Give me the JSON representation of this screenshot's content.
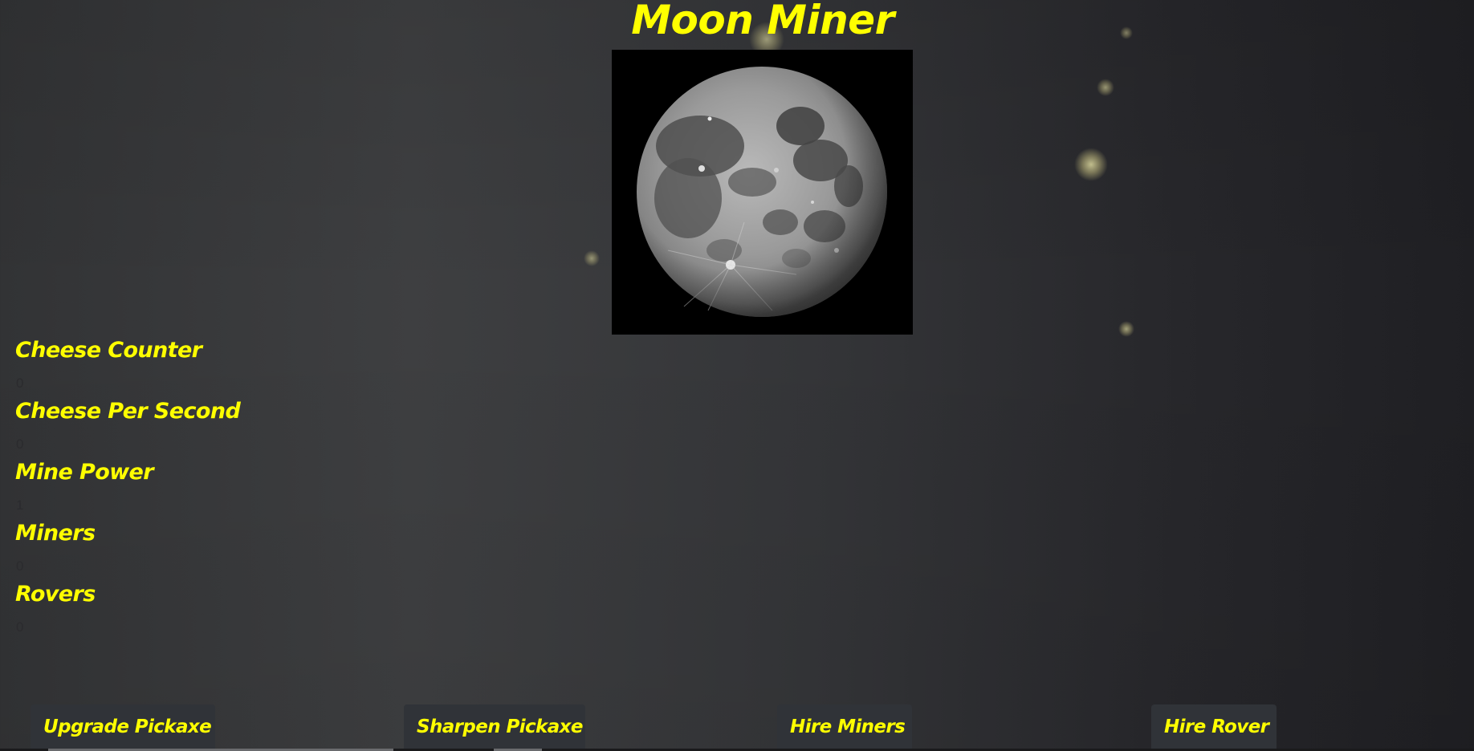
{
  "title": "Moon Miner",
  "moon": {
    "icon": "moon-image"
  },
  "stats": [
    {
      "label": "Cheese Counter",
      "value": "0"
    },
    {
      "label": "Cheese Per Second",
      "value": "0"
    },
    {
      "label": "Mine Power",
      "value": "1"
    },
    {
      "label": "Miners",
      "value": "0"
    },
    {
      "label": "Rovers",
      "value": "0"
    }
  ],
  "buttons": {
    "upgrade_pickaxe": "Upgrade Pickaxe",
    "sharpen_pickaxe": "Sharpen Pickaxe",
    "hire_miners": "Hire Miners",
    "hire_rover": "Hire Rover"
  },
  "colors": {
    "accent": "#ffff00",
    "button_bg": "#303338",
    "background": "#3e3f41"
  }
}
